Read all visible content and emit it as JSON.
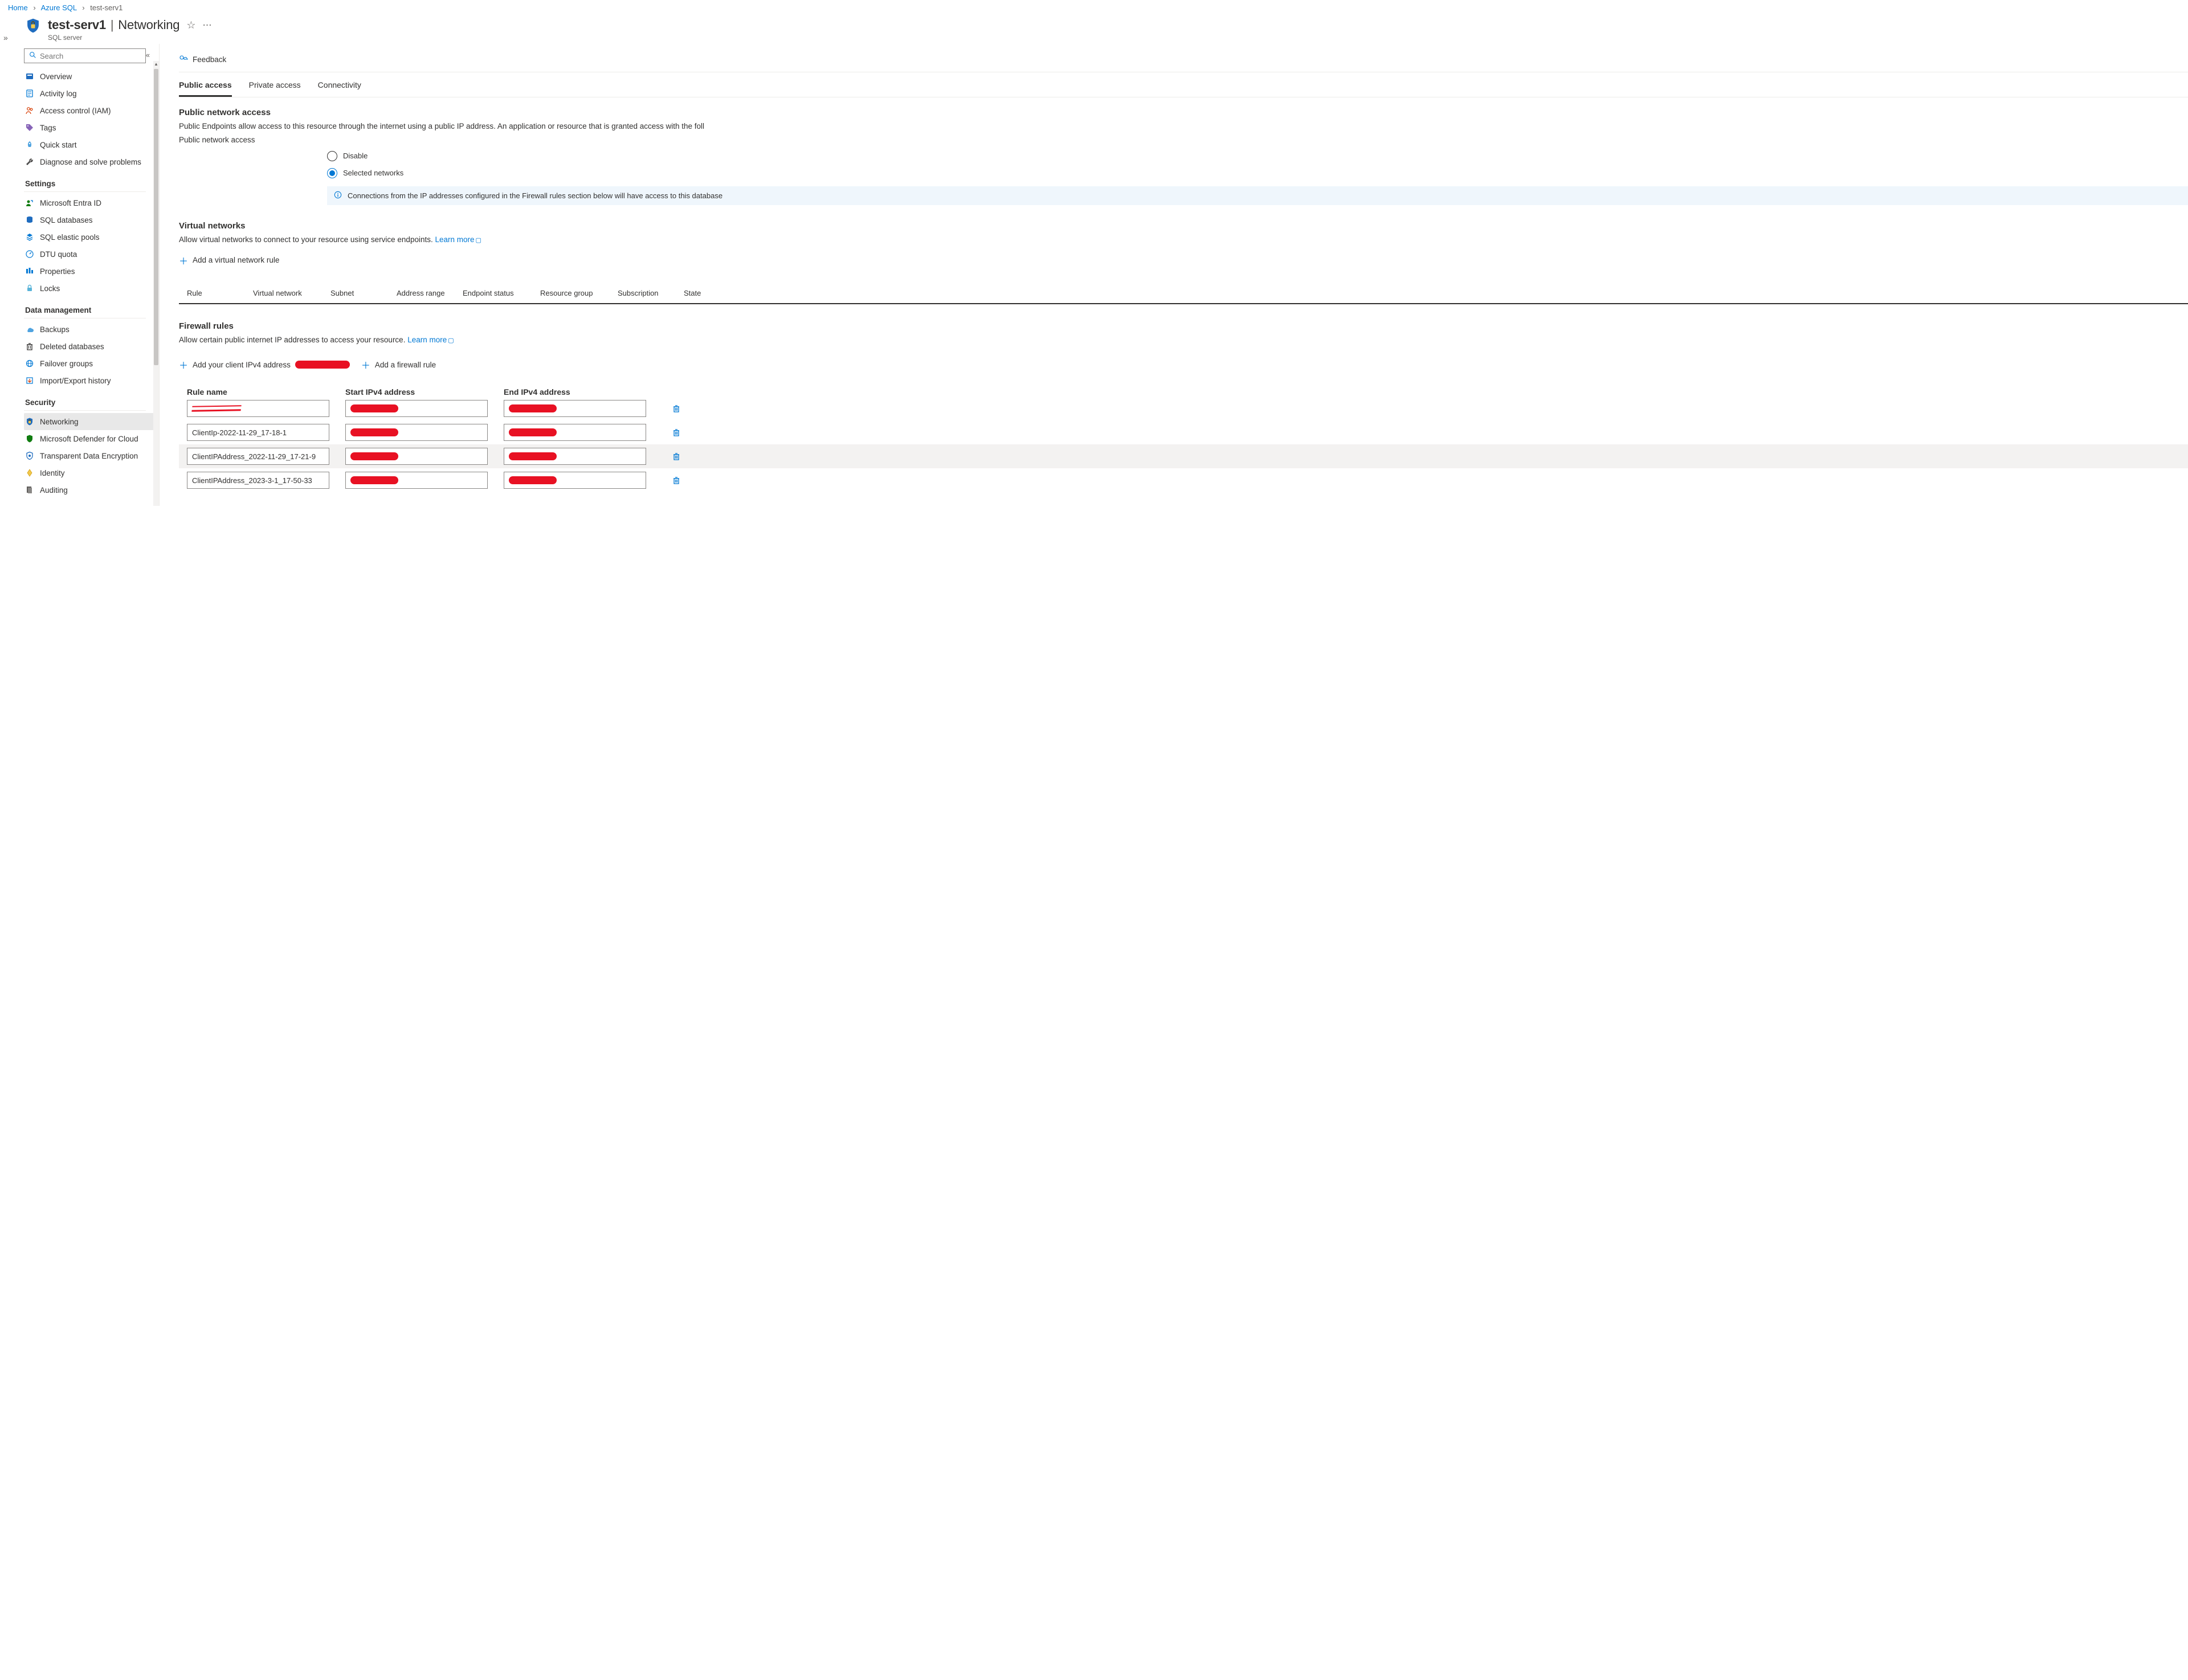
{
  "breadcrumb": {
    "items": [
      "Home",
      "Azure SQL",
      "test-serv1"
    ]
  },
  "header": {
    "resource_name": "test-serv1",
    "section": "Networking",
    "subtitle": "SQL server"
  },
  "sidebar": {
    "search_placeholder": "Search",
    "top": [
      {
        "label": "Overview",
        "icon": "sql-icon"
      },
      {
        "label": "Activity log",
        "icon": "log-icon"
      },
      {
        "label": "Access control (IAM)",
        "icon": "people-icon"
      },
      {
        "label": "Tags",
        "icon": "tag-icon"
      },
      {
        "label": "Quick start",
        "icon": "rocket-icon"
      },
      {
        "label": "Diagnose and solve problems",
        "icon": "wrench-icon"
      }
    ],
    "groups": [
      {
        "title": "Settings",
        "items": [
          {
            "label": "Microsoft Entra ID",
            "icon": "entra-icon"
          },
          {
            "label": "SQL databases",
            "icon": "db-icon"
          },
          {
            "label": "SQL elastic pools",
            "icon": "pool-icon"
          },
          {
            "label": "DTU quota",
            "icon": "gauge-icon"
          },
          {
            "label": "Properties",
            "icon": "props-icon"
          },
          {
            "label": "Locks",
            "icon": "lock-icon"
          }
        ]
      },
      {
        "title": "Data management",
        "items": [
          {
            "label": "Backups",
            "icon": "backup-icon"
          },
          {
            "label": "Deleted databases",
            "icon": "trash-icon"
          },
          {
            "label": "Failover groups",
            "icon": "globe-icon"
          },
          {
            "label": "Import/Export history",
            "icon": "import-icon"
          }
        ]
      },
      {
        "title": "Security",
        "items": [
          {
            "label": "Networking",
            "icon": "shield-icon",
            "selected": true
          },
          {
            "label": "Microsoft Defender for Cloud",
            "icon": "defender-icon"
          },
          {
            "label": "Transparent Data Encryption",
            "icon": "tde-icon"
          },
          {
            "label": "Identity",
            "icon": "identity-icon"
          },
          {
            "label": "Auditing",
            "icon": "audit-icon"
          }
        ]
      }
    ]
  },
  "main": {
    "feedback_label": "Feedback",
    "tabs": [
      "Public access",
      "Private access",
      "Connectivity"
    ],
    "active_tab": 0,
    "public_access": {
      "heading": "Public network access",
      "description": "Public Endpoints allow access to this resource through the internet using a public IP address. An application or resource that is granted access with the foll",
      "subheading": "Public network access",
      "radio_disable": "Disable",
      "radio_selected": "Selected networks",
      "info_text": "Connections from the IP addresses configured in the Firewall rules section below will have access to this database"
    },
    "virtual_networks": {
      "heading": "Virtual networks",
      "description": "Allow virtual networks to connect to your resource using service endpoints. ",
      "learn_more": "Learn more",
      "add_rule_label": "Add a virtual network rule",
      "columns": [
        "Rule",
        "Virtual network",
        "Subnet",
        "Address range",
        "Endpoint status",
        "Resource group",
        "Subscription",
        "State"
      ]
    },
    "firewall": {
      "heading": "Firewall rules",
      "description": "Allow certain public internet IP addresses to access your resource. ",
      "learn_more": "Learn more",
      "add_client_label": "Add your client IPv4 address ",
      "add_rule_label": "Add a firewall rule",
      "columns": [
        "Rule name",
        "Start IPv4 address",
        "End IPv4 address"
      ],
      "rules": [
        {
          "name": "[redacted]",
          "start": "[redacted]",
          "end": "[redacted]"
        },
        {
          "name": "ClientIp-2022-11-29_17-18-1",
          "start": "[redacted]",
          "end": "[redacted]"
        },
        {
          "name": "ClientIPAddress_2022-11-29_17-21-9",
          "start": "[redacted]",
          "end": "[redacted]"
        },
        {
          "name": "ClientIPAddress_2023-3-1_17-50-33",
          "start": "[redacted]",
          "end": "[redacted]"
        }
      ]
    }
  },
  "colors": {
    "primary": "#0078d4",
    "danger": "#e81123"
  }
}
